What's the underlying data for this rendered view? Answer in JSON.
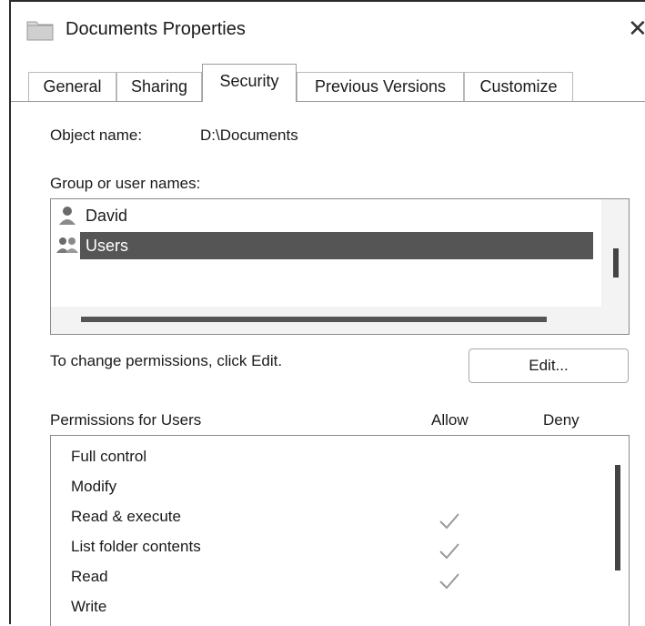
{
  "window": {
    "title": "Documents Properties",
    "close_glyph": "✕",
    "folder_icon": "folder-icon"
  },
  "tabs": [
    {
      "label": "General",
      "active": false
    },
    {
      "label": "Sharing",
      "active": false
    },
    {
      "label": "Security",
      "active": true
    },
    {
      "label": "Previous Versions",
      "active": false
    },
    {
      "label": "Customize",
      "active": false
    }
  ],
  "security": {
    "object_name_label": "Object name:",
    "object_name_value": "D:\\Documents",
    "group_label": "Group or user names:",
    "users": [
      {
        "name": "David",
        "icon": "user-icon",
        "selected": false
      },
      {
        "name": "Users",
        "icon": "users-group-icon",
        "selected": true
      }
    ],
    "change_hint": "To change permissions, click Edit.",
    "edit_button": "Edit...",
    "permissions_header": "Permissions for Users",
    "allow_header": "Allow",
    "deny_header": "Deny",
    "permissions": [
      {
        "name": "Full control",
        "allow": false,
        "deny": false
      },
      {
        "name": "Modify",
        "allow": false,
        "deny": false
      },
      {
        "name": "Read & execute",
        "allow": true,
        "deny": false
      },
      {
        "name": "List folder contents",
        "allow": true,
        "deny": false
      },
      {
        "name": "Read",
        "allow": true,
        "deny": false
      },
      {
        "name": "Write",
        "allow": false,
        "deny": false
      }
    ]
  },
  "colors": {
    "selection": "#555555",
    "check": "#9a9a9a",
    "border": "#8a8a8a"
  }
}
